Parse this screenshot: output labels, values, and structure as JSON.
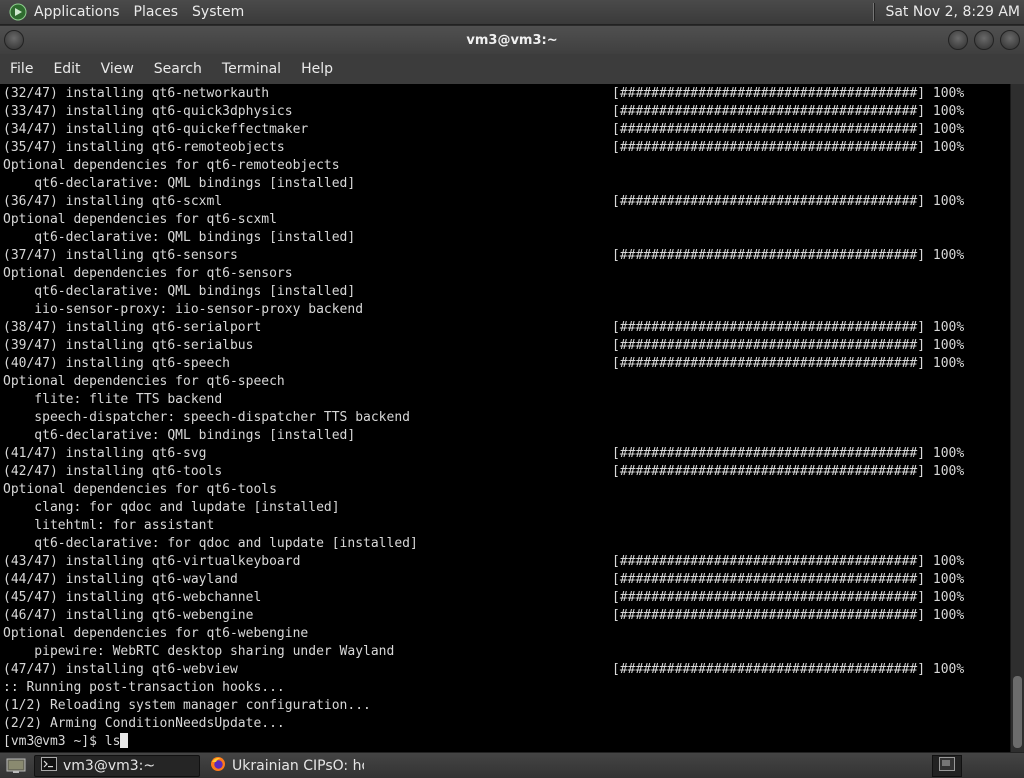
{
  "top_panel": {
    "menus": [
      "Applications",
      "Places",
      "System"
    ],
    "clock": "Sat Nov  2,  8:29 AM"
  },
  "window": {
    "title": "vm3@vm3:~",
    "menus": [
      "File",
      "Edit",
      "View",
      "Search",
      "Terminal",
      "Help"
    ]
  },
  "terminal": {
    "lines": [
      {
        "text": "(32/47) installing qt6-networkauth",
        "bar": "[######################################] 100%"
      },
      {
        "text": "(33/47) installing qt6-quick3dphysics",
        "bar": "[######################################] 100%"
      },
      {
        "text": "(34/47) installing qt6-quickeffectmaker",
        "bar": "[######################################] 100%"
      },
      {
        "text": "(35/47) installing qt6-remoteobjects",
        "bar": "[######################################] 100%"
      },
      {
        "text": "Optional dependencies for qt6-remoteobjects",
        "bar": ""
      },
      {
        "text": "    qt6-declarative: QML bindings [installed]",
        "bar": ""
      },
      {
        "text": "(36/47) installing qt6-scxml",
        "bar": "[######################################] 100%"
      },
      {
        "text": "Optional dependencies for qt6-scxml",
        "bar": ""
      },
      {
        "text": "    qt6-declarative: QML bindings [installed]",
        "bar": ""
      },
      {
        "text": "(37/47) installing qt6-sensors",
        "bar": "[######################################] 100%"
      },
      {
        "text": "Optional dependencies for qt6-sensors",
        "bar": ""
      },
      {
        "text": "    qt6-declarative: QML bindings [installed]",
        "bar": ""
      },
      {
        "text": "    iio-sensor-proxy: iio-sensor-proxy backend",
        "bar": ""
      },
      {
        "text": "(38/47) installing qt6-serialport",
        "bar": "[######################################] 100%"
      },
      {
        "text": "(39/47) installing qt6-serialbus",
        "bar": "[######################################] 100%"
      },
      {
        "text": "(40/47) installing qt6-speech",
        "bar": "[######################################] 100%"
      },
      {
        "text": "Optional dependencies for qt6-speech",
        "bar": ""
      },
      {
        "text": "    flite: flite TTS backend",
        "bar": ""
      },
      {
        "text": "    speech-dispatcher: speech-dispatcher TTS backend",
        "bar": ""
      },
      {
        "text": "    qt6-declarative: QML bindings [installed]",
        "bar": ""
      },
      {
        "text": "(41/47) installing qt6-svg",
        "bar": "[######################################] 100%"
      },
      {
        "text": "(42/47) installing qt6-tools",
        "bar": "[######################################] 100%"
      },
      {
        "text": "Optional dependencies for qt6-tools",
        "bar": ""
      },
      {
        "text": "    clang: for qdoc and lupdate [installed]",
        "bar": ""
      },
      {
        "text": "    litehtml: for assistant",
        "bar": ""
      },
      {
        "text": "    qt6-declarative: for qdoc and lupdate [installed]",
        "bar": ""
      },
      {
        "text": "(43/47) installing qt6-virtualkeyboard",
        "bar": "[######################################] 100%"
      },
      {
        "text": "(44/47) installing qt6-wayland",
        "bar": "[######################################] 100%"
      },
      {
        "text": "(45/47) installing qt6-webchannel",
        "bar": "[######################################] 100%"
      },
      {
        "text": "(46/47) installing qt6-webengine",
        "bar": "[######################################] 100%"
      },
      {
        "text": "Optional dependencies for qt6-webengine",
        "bar": ""
      },
      {
        "text": "    pipewire: WebRTC desktop sharing under Wayland",
        "bar": ""
      },
      {
        "text": "(47/47) installing qt6-webview",
        "bar": "[######################################] 100%"
      },
      {
        "text": ":: Running post-transaction hooks...",
        "bar": ""
      },
      {
        "text": "(1/2) Reloading system manager configuration...",
        "bar": ""
      },
      {
        "text": "(2/2) Arming ConditionNeedsUpdate...",
        "bar": ""
      }
    ],
    "prompt": "[vm3@vm3 ~]$ ls"
  },
  "taskbar": {
    "tasks": [
      {
        "label": "vm3@vm3:~",
        "icon": "terminal-icon"
      },
      {
        "label": "Ukrainian CIPsO: ho...",
        "icon": "firefox-icon"
      }
    ]
  },
  "colors": {
    "terminal_bg": "#000000",
    "terminal_fg": "#d8d8d8",
    "panel": "#3a3a3a"
  }
}
